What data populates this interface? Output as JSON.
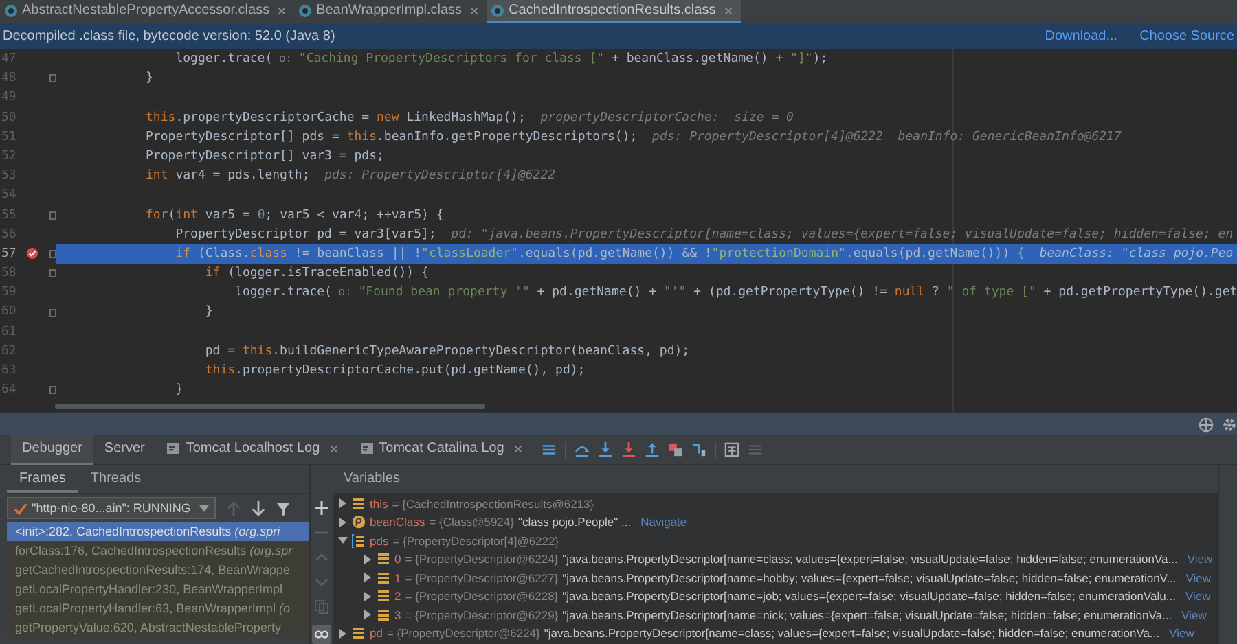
{
  "editor_tabs": [
    {
      "label": "AbstractNestablePropertyAccessor.class",
      "selected": false
    },
    {
      "label": "BeanWrapperImpl.class",
      "selected": false
    },
    {
      "label": "CachedIntrospectionResults.class",
      "selected": true
    }
  ],
  "info_bar": {
    "message": "Decompiled .class file, bytecode version: 52.0 (Java 8)",
    "links": [
      "Download...",
      "Choose Source"
    ]
  },
  "code": {
    "lines": [
      {
        "number": "47",
        "breakpoint": false,
        "current": false,
        "fold": false,
        "tokens": [
          {
            "kind": "plain",
            "text": "                logger.trace("
          },
          {
            "kind": "hint",
            "text": " o: "
          },
          {
            "kind": "string",
            "text": "\"Caching PropertyDescriptors for class [\""
          },
          {
            "kind": "plain",
            "text": " + beanClass.getName() + "
          },
          {
            "kind": "string",
            "text": "\"]\""
          },
          {
            "kind": "plain",
            "text": ");"
          }
        ]
      },
      {
        "number": "48",
        "breakpoint": false,
        "current": false,
        "fold": true,
        "tokens": [
          {
            "kind": "plain",
            "text": "            }"
          }
        ]
      },
      {
        "number": "49",
        "breakpoint": false,
        "current": false,
        "fold": false
      },
      {
        "number": "50",
        "breakpoint": false,
        "current": false,
        "fold": false,
        "tokens": [
          {
            "kind": "keyword",
            "text": "            this"
          },
          {
            "kind": "plain",
            "text": ".propertyDescriptorCache = "
          },
          {
            "kind": "keyword",
            "text": "new"
          },
          {
            "kind": "plain",
            "text": " LinkedHashMap();"
          }
        ],
        "inline_value": "propertyDescriptorCache:  size = 0"
      },
      {
        "number": "51",
        "breakpoint": false,
        "current": false,
        "fold": false,
        "tokens": [
          {
            "kind": "plain",
            "text": "            PropertyDescriptor[] pds = "
          },
          {
            "kind": "keyword",
            "text": "this"
          },
          {
            "kind": "plain",
            "text": ".beanInfo.getPropertyDescriptors();"
          }
        ],
        "inline_value": "pds: PropertyDescriptor[4]@6222  beanInfo: GenericBeanInfo@6217"
      },
      {
        "number": "52",
        "breakpoint": false,
        "current": false,
        "fold": false,
        "tokens": [
          {
            "kind": "plain",
            "text": "            PropertyDescriptor[] var3 = pds;"
          }
        ]
      },
      {
        "number": "53",
        "breakpoint": false,
        "current": false,
        "fold": false,
        "tokens": [
          {
            "kind": "keyword",
            "text": "            int"
          },
          {
            "kind": "plain",
            "text": " var4 = pds.length;"
          }
        ],
        "inline_value": "pds: PropertyDescriptor[4]@6222"
      },
      {
        "number": "54",
        "breakpoint": false,
        "current": false,
        "fold": false
      },
      {
        "number": "55",
        "breakpoint": false,
        "current": false,
        "fold": true,
        "tokens": [
          {
            "kind": "keyword",
            "text": "            for"
          },
          {
            "kind": "plain",
            "text": "("
          },
          {
            "kind": "keyword",
            "text": "int"
          },
          {
            "kind": "plain",
            "text": " var5 = "
          },
          {
            "kind": "number",
            "text": "0"
          },
          {
            "kind": "plain",
            "text": "; var5 < var4; ++var5) {"
          }
        ]
      },
      {
        "number": "56",
        "breakpoint": false,
        "current": false,
        "fold": false,
        "tokens": [
          {
            "kind": "plain",
            "text": "                PropertyDescriptor pd = var3[var5];"
          }
        ],
        "inline_value": "pd: \"java.beans.PropertyDescriptor[name=class; values={expert=false; visualUpdate=false; hidden=false; en"
      },
      {
        "number": "57",
        "breakpoint": true,
        "current": true,
        "fold": true,
        "tokens": [
          {
            "kind": "keyword",
            "text": "                if"
          },
          {
            "kind": "plain",
            "text": " (Class."
          },
          {
            "kind": "keyword",
            "text": "class"
          },
          {
            "kind": "plain",
            "text": " != beanClass || !"
          },
          {
            "kind": "string",
            "text": "\"classLoader\""
          },
          {
            "kind": "plain",
            "text": ".equals(pd.getName()) && !"
          },
          {
            "kind": "string",
            "text": "\"protectionDomain\""
          },
          {
            "kind": "plain",
            "text": ".equals(pd.getName())) {"
          }
        ],
        "inline_value": "beanClass: \"class pojo.Peo"
      },
      {
        "number": "58",
        "breakpoint": false,
        "current": false,
        "fold": true,
        "tokens": [
          {
            "kind": "keyword",
            "text": "                    if"
          },
          {
            "kind": "plain",
            "text": " (logger.isTraceEnabled()) {"
          }
        ]
      },
      {
        "number": "59",
        "breakpoint": false,
        "current": false,
        "fold": false,
        "tokens": [
          {
            "kind": "plain",
            "text": "                        logger.trace("
          },
          {
            "kind": "hint",
            "text": " o: "
          },
          {
            "kind": "string",
            "text": "\"Found bean property '\""
          },
          {
            "kind": "plain",
            "text": " + pd.getName() + "
          },
          {
            "kind": "string",
            "text": "\"'\""
          },
          {
            "kind": "plain",
            "text": " + (pd.getPropertyType() != "
          },
          {
            "kind": "keyword",
            "text": "null"
          },
          {
            "kind": "plain",
            "text": " ? "
          },
          {
            "kind": "string",
            "text": "\" of type [\""
          },
          {
            "kind": "plain",
            "text": " + pd.getPropertyType().get"
          }
        ]
      },
      {
        "number": "60",
        "breakpoint": false,
        "current": false,
        "fold": true,
        "tokens": [
          {
            "kind": "plain",
            "text": "                    }"
          }
        ]
      },
      {
        "number": "61",
        "breakpoint": false,
        "current": false,
        "fold": false
      },
      {
        "number": "62",
        "breakpoint": false,
        "current": false,
        "fold": false,
        "tokens": [
          {
            "kind": "plain",
            "text": "                    pd = "
          },
          {
            "kind": "keyword",
            "text": "this"
          },
          {
            "kind": "plain",
            "text": ".buildGenericTypeAwarePropertyDescriptor(beanClass, pd);"
          }
        ]
      },
      {
        "number": "63",
        "breakpoint": false,
        "current": false,
        "fold": false,
        "tokens": [
          {
            "kind": "keyword",
            "text": "                    this"
          },
          {
            "kind": "plain",
            "text": ".propertyDescriptorCache.put(pd.getName(), pd);"
          }
        ]
      },
      {
        "number": "64",
        "breakpoint": false,
        "current": false,
        "fold": true,
        "tokens": [
          {
            "kind": "plain",
            "text": "                }"
          }
        ]
      }
    ]
  },
  "debug_tabs": [
    {
      "label": "Debugger",
      "selected": true,
      "closable": false
    },
    {
      "label": "Server",
      "selected": false,
      "closable": false
    },
    {
      "label": "Tomcat Localhost Log",
      "selected": false,
      "closable": true
    },
    {
      "label": "Tomcat Catalina Log",
      "selected": false,
      "closable": true
    }
  ],
  "subtabs": [
    {
      "label": "Frames",
      "selected": true
    },
    {
      "label": "Threads",
      "selected": false
    }
  ],
  "variables_title": "Variables",
  "thread": {
    "label": "\"http-nio-80...ain\": RUNNING"
  },
  "frames": [
    {
      "text": "<init>:282, CachedIntrospectionResults *(org.spri*",
      "selected": true
    },
    {
      "text": "forClass:176, CachedIntrospectionResults *(org.spr*",
      "selected": false
    },
    {
      "text": "getCachedIntrospectionResults:174, BeanWrappe",
      "selected": false
    },
    {
      "text": "getLocalPropertyHandler:230, BeanWrapperImpl",
      "selected": false
    },
    {
      "text": "getLocalPropertyHandler:63, BeanWrapperImpl *(o*",
      "selected": false
    },
    {
      "text": "getPropertyValue:620, AbstractNestableProperty",
      "selected": false
    }
  ],
  "variables": [
    {
      "name": "this",
      "kind": "field",
      "expanded": false,
      "value": "= {CachedIntrospectionResults@6213}"
    },
    {
      "name": "beanClass",
      "kind": "param",
      "expanded": false,
      "value": "= {Class@5924}",
      "text": "\"class pojo.People\" ...",
      "link": "Navigate"
    },
    {
      "name": "pds",
      "kind": "array",
      "expanded": true,
      "value": "= {PropertyDescriptor[4]@6222}",
      "children": [
        {
          "name": "0",
          "kind": "field",
          "expanded": false,
          "value": "= {PropertyDescriptor@6224}",
          "text": "\"java.beans.PropertyDescriptor[name=class; values={expert=false; visualUpdate=false; hidden=false; enumerationVa...",
          "link": "View"
        },
        {
          "name": "1",
          "kind": "field",
          "expanded": false,
          "value": "= {PropertyDescriptor@6227}",
          "text": "\"java.beans.PropertyDescriptor[name=hobby; values={expert=false; visualUpdate=false; hidden=false; enumerationV...",
          "link": "View"
        },
        {
          "name": "2",
          "kind": "field",
          "expanded": false,
          "value": "= {PropertyDescriptor@6228}",
          "text": "\"java.beans.PropertyDescriptor[name=job; values={expert=false; visualUpdate=false; hidden=false; enumerationValu...",
          "link": "View"
        },
        {
          "name": "3",
          "kind": "field",
          "expanded": false,
          "value": "= {PropertyDescriptor@6229}",
          "text": "\"java.beans.PropertyDescriptor[name=nick; values={expert=false; visualUpdate=false; hidden=false; enumerationVa...",
          "link": "View"
        }
      ]
    },
    {
      "name": "pd",
      "kind": "field",
      "expanded": false,
      "value": "= {PropertyDescriptor@6224}",
      "text": "\"java.beans.PropertyDescriptor[name=class; values={expert=false; visualUpdate=false; hidden=false; enumerationVa...",
      "link": "View"
    }
  ]
}
